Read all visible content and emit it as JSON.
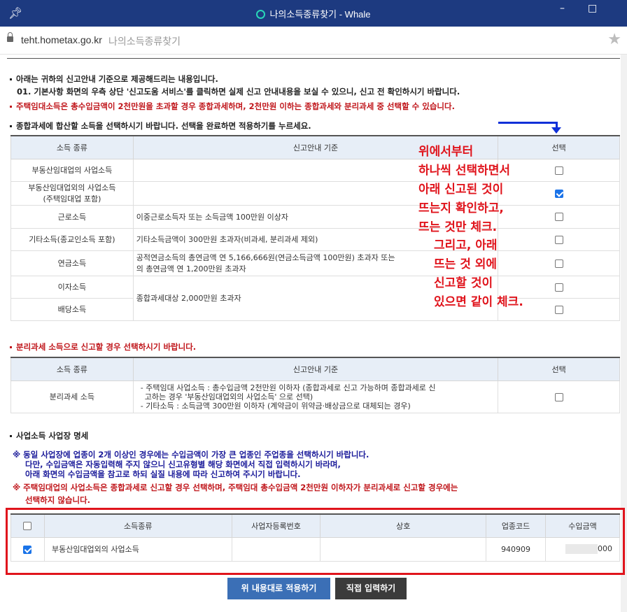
{
  "window": {
    "title": "나의소득종류찾기 - Whale",
    "host": "teht.hometax.go.kr",
    "page_name": "나의소득종류찾기",
    "controls": {
      "minimize": "–",
      "maximize": "□"
    }
  },
  "notices": {
    "intro1": "아래는 귀하의 신고안내 기준으로 제공해드리는 내용입니다.",
    "intro2": "01. 기본사항 화면의 우측 상단 '신고도움 서비스'를 클릭하면 실제 신고 안내내용을 보실 수 있으니, 신고 전 확인하시기 바랍니다.",
    "housing_rent": "주택임대소득은 총수입금액이 2천만원을 초과할 경우 종합과세하며, 2천만원 이하는 종합과세와 분리과세 중 선택할 수 있습니다.",
    "comprehensive_heading": "종합과세에 합산할 소득을 선택하시기 바랍니다. 선택을 완료하면 적용하기를 누르세요."
  },
  "income_table": {
    "headers": [
      "소득 종류",
      "신고안내 기준",
      "선택"
    ],
    "rows": [
      {
        "type": "부동산임대업의 사업소득",
        "type2": "",
        "criteria": "",
        "checked": false
      },
      {
        "type": "부동산임대업외의 사업소득",
        "type2": "(주택임대업 포함)",
        "criteria": "",
        "checked": true
      },
      {
        "type": "근로소득",
        "type2": "",
        "criteria": "이중근로소득자 또는 소득금액 100만원 이상자",
        "checked": false
      },
      {
        "type": "기타소득(종교인소득 포함)",
        "type2": "",
        "criteria": "기타소득금액이 300만원 초과자(비과세, 분리과세 제외)",
        "checked": false
      },
      {
        "type": "연금소득",
        "type2": "",
        "criteria": "공적연금소득의 총연금액 연 5,166,666원(연금소득금액 100만원) 초과자 또는",
        "criteria2": "의 총연금액 연 1,200만원 초과자",
        "checked": false
      },
      {
        "type": "이자소득",
        "type2": "",
        "checked": false
      },
      {
        "type": "배당소득",
        "type2": "",
        "checked": false
      }
    ],
    "interest_dividend_criteria": "종합과세대상 2,000만원 초과자"
  },
  "separate": {
    "heading": "분리과세 소득으로 신고할 경우 선택하시기 바랍니다.",
    "headers": [
      "소득 종류",
      "신고안내 기준",
      "선택"
    ],
    "type": "분리과세 소득",
    "line1": "- 주택임대 사업소득 : 총수입금액 2천만원 이하자 (종합과세로 신고 가능하며 종합과세로 신",
    "line2": "고하는 경우 '부동산임대업외의 사업소득' 으로 선택)",
    "line3": "- 기타소득 : 소득금액 300만원 이하자 (계약금이 위약금·배상금으로 대체되는 경우)",
    "checked": false
  },
  "business": {
    "heading": "사업소득 사업장 명세",
    "note1": "※ 동일 사업장에 업종이 2개 이상인 경우에는 수입금액이 가장 큰 업종인 주업종을 선택하시기 바랍니다.",
    "note2": "다만, 수입금액은 자동입력해 주지 않으니 신고유형별 해당 화면에서 직접 입력하시기 바라며,",
    "note3": "아래 화면의 수입금액을 참고로 하되 실질 내용에 따라 신고하여 주시기 바랍니다.",
    "note4": "※ 주택임대업의 사업소득은 종합과세로 신고할 경우 선택하며, 주택임대 총수입금액 2천만원 이하자가 분리과세로 신고할 경우에는",
    "note5": "선택하지 않습니다.",
    "headers": [
      "소득종류",
      "사업자등록번호",
      "상호",
      "업종코드",
      "수입금액"
    ],
    "rows": [
      {
        "checked": true,
        "income_type": "부동산임대업외의 사업소득",
        "reg_no": "",
        "name": "",
        "code": "940909",
        "amount_suffix": "000"
      }
    ]
  },
  "buttons": {
    "apply": "위 내용대로 적용하기",
    "direct": "직접 입력하기"
  },
  "annotation": {
    "lines": [
      "위에서부터",
      "하나씩 선택하면서",
      "아래 신고된 것이",
      "뜨는지 확인하고,",
      "뜨는 것만 체크."
    ],
    "lines2": [
      "그리고, 아래",
      "뜨는 것 외에",
      "신고할 것이",
      "있으면 같이 체크."
    ],
    "color": "#e0141c",
    "arrow_color": "#1030d8"
  }
}
